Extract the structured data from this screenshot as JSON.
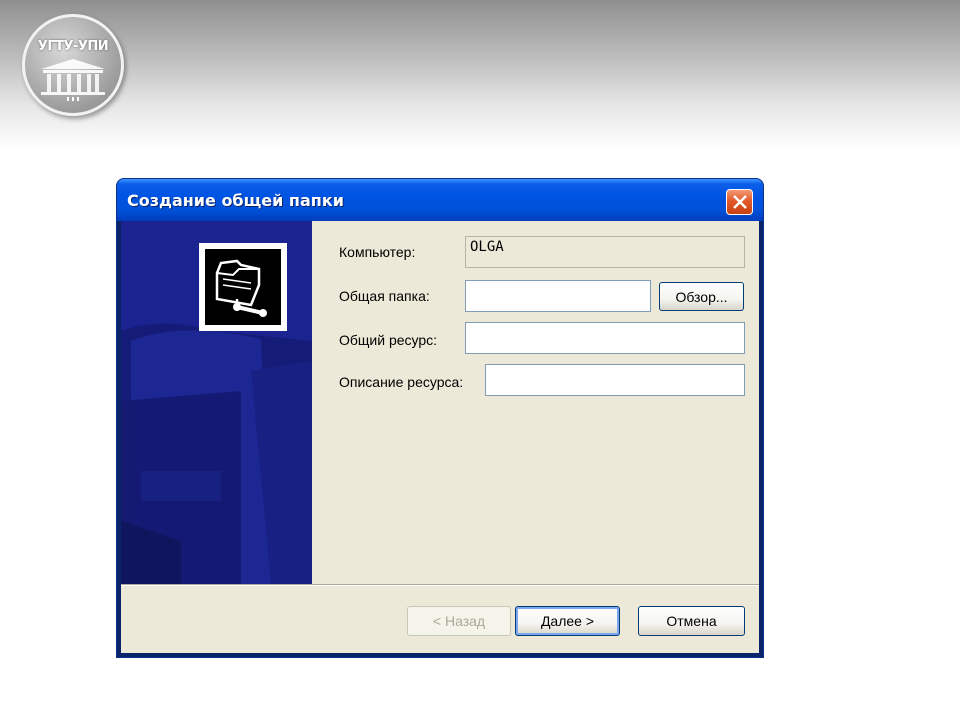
{
  "logo": {
    "text": "УГТУ-УПИ"
  },
  "dialog": {
    "title": "Создание общей папки",
    "fields": {
      "computer": {
        "label": "Компьютер:",
        "value": "OLGA"
      },
      "shared_folder": {
        "label": "Общая папка:",
        "value": ""
      },
      "share_name": {
        "label": "Общий ресурс:",
        "value": ""
      },
      "description": {
        "label": "Описание ресурса:",
        "value": ""
      }
    },
    "buttons": {
      "browse": "Обзор...",
      "back": "< Назад",
      "next": "Далее >",
      "cancel": "Отмена"
    }
  },
  "colors": {
    "titlebar": "#0054e3",
    "side_panel": "#1a2280",
    "client": "#ece9d8",
    "close": "#e25a2a"
  },
  "icons": [
    "shared-folder-icon",
    "close-icon"
  ]
}
